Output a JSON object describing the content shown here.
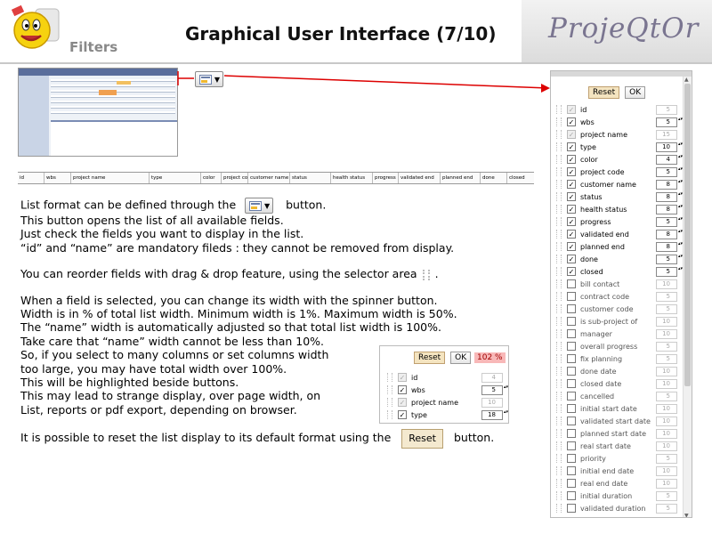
{
  "header": {
    "logo_label": "Filters",
    "title": "Graphical User Interface (7/10)",
    "brand": "ProjeQtOr"
  },
  "column_strip": [
    "id",
    "wbs",
    "project name",
    "type",
    "color",
    "project code",
    "customer name",
    "status",
    "health status",
    "progress",
    "validated end",
    "planned end",
    "done",
    "closed"
  ],
  "body": {
    "p1a": "List format can be defined through the",
    "p1b": "button.",
    "p2": "This button opens the list of all available fields.",
    "p3": "Just check the fields you want to display in the list.",
    "p4": "“id” and “name” are mandatory fileds : they cannot be removed from display.",
    "p5a": "You can reorder fields with drag & drop feature, using the selector area",
    "p5b": ".",
    "p6": "When a field is selected, you can change its width with the spinner button.",
    "p7": "Width is in % of total list width. Minimum width is 1%. Maximum width is 50%.",
    "p8": "The “name” width is automatically adjusted so that total list width is 100%.",
    "p9": "Take care that “name” width cannot be less than 10%.",
    "p10": "So, if you select to many columns or set columns width",
    "p11": "too large, you may have total width over 100%.",
    "p12": "This will be highlighted beside buttons.",
    "p13": "This may lead to strange display, over page width, on",
    "p14": "List, reports or pdf export, depending on browser.",
    "p15a": "It is possible to reset the list display to its default format using the",
    "p15b": "button.",
    "reset_label": "Reset"
  },
  "popup_small": {
    "reset": "Reset",
    "ok": "OK",
    "total": "102 %",
    "rows": [
      {
        "label": "id",
        "checked": true,
        "disabled": true,
        "width": "4"
      },
      {
        "label": "wbs",
        "checked": true,
        "disabled": false,
        "width": "5"
      },
      {
        "label": "project name",
        "checked": true,
        "disabled": true,
        "width": "10"
      },
      {
        "label": "type",
        "checked": true,
        "disabled": false,
        "width": "18"
      }
    ]
  },
  "panel": {
    "reset": "Reset",
    "ok": "OK",
    "rows": [
      {
        "label": "id",
        "checked": true,
        "disabled": true,
        "width": "5"
      },
      {
        "label": "wbs",
        "checked": true,
        "disabled": false,
        "width": "5"
      },
      {
        "label": "project name",
        "checked": true,
        "disabled": true,
        "width": "15"
      },
      {
        "label": "type",
        "checked": true,
        "disabled": false,
        "width": "10"
      },
      {
        "label": "color",
        "checked": true,
        "disabled": false,
        "width": "4"
      },
      {
        "label": "project code",
        "checked": true,
        "disabled": false,
        "width": "5"
      },
      {
        "label": "customer name",
        "checked": true,
        "disabled": false,
        "width": "8"
      },
      {
        "label": "status",
        "checked": true,
        "disabled": false,
        "width": "8"
      },
      {
        "label": "health status",
        "checked": true,
        "disabled": false,
        "width": "8"
      },
      {
        "label": "progress",
        "checked": true,
        "disabled": false,
        "width": "5"
      },
      {
        "label": "validated end",
        "checked": true,
        "disabled": false,
        "width": "8"
      },
      {
        "label": "planned end",
        "checked": true,
        "disabled": false,
        "width": "8"
      },
      {
        "label": "done",
        "checked": true,
        "disabled": false,
        "width": "5"
      },
      {
        "label": "closed",
        "checked": true,
        "disabled": false,
        "width": "5"
      },
      {
        "label": "bill contact",
        "checked": false,
        "disabled": false,
        "width": "10"
      },
      {
        "label": "contract code",
        "checked": false,
        "disabled": false,
        "width": "5"
      },
      {
        "label": "customer code",
        "checked": false,
        "disabled": false,
        "width": "5"
      },
      {
        "label": "is sub-project of",
        "checked": false,
        "disabled": false,
        "width": "10"
      },
      {
        "label": "manager",
        "checked": false,
        "disabled": false,
        "width": "10"
      },
      {
        "label": "overall progress",
        "checked": false,
        "disabled": false,
        "width": "5"
      },
      {
        "label": "fix planning",
        "checked": false,
        "disabled": false,
        "width": "5"
      },
      {
        "label": "done date",
        "checked": false,
        "disabled": false,
        "width": "10"
      },
      {
        "label": "closed date",
        "checked": false,
        "disabled": false,
        "width": "10"
      },
      {
        "label": "cancelled",
        "checked": false,
        "disabled": false,
        "width": "5"
      },
      {
        "label": "initial start date",
        "checked": false,
        "disabled": false,
        "width": "10"
      },
      {
        "label": "validated start date",
        "checked": false,
        "disabled": false,
        "width": "10"
      },
      {
        "label": "planned start date",
        "checked": false,
        "disabled": false,
        "width": "10"
      },
      {
        "label": "real start date",
        "checked": false,
        "disabled": false,
        "width": "10"
      },
      {
        "label": "priority",
        "checked": false,
        "disabled": false,
        "width": "5"
      },
      {
        "label": "initial end date",
        "checked": false,
        "disabled": false,
        "width": "10"
      },
      {
        "label": "real end date",
        "checked": false,
        "disabled": false,
        "width": "10"
      },
      {
        "label": "initial duration",
        "checked": false,
        "disabled": false,
        "width": "5"
      },
      {
        "label": "validated duration",
        "checked": false,
        "disabled": false,
        "width": "5"
      }
    ]
  }
}
